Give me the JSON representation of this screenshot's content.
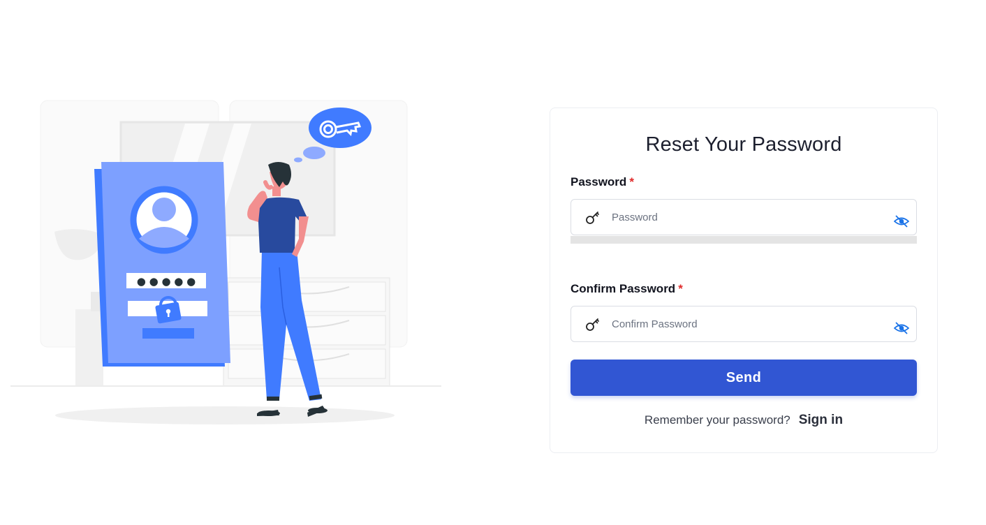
{
  "form": {
    "title": "Reset Your Password",
    "password_label": "Password",
    "password_placeholder": "Password",
    "confirm_label": "Confirm Password",
    "confirm_placeholder": "Confirm Password",
    "required_mark": "*",
    "send_label": "Send",
    "remember_text": "Remember your password?",
    "signin_label": "Sign in"
  },
  "illustration": {
    "password_dots": "● ● ● ● ●"
  },
  "colors": {
    "primary_button": "#3156d3",
    "accent_blue": "#407bff",
    "required": "#e02a2a",
    "eye_icon": "#1a73e8"
  },
  "icons": {
    "field_icon": "key-icon",
    "visibility_toggle": "eye-slash-icon"
  }
}
